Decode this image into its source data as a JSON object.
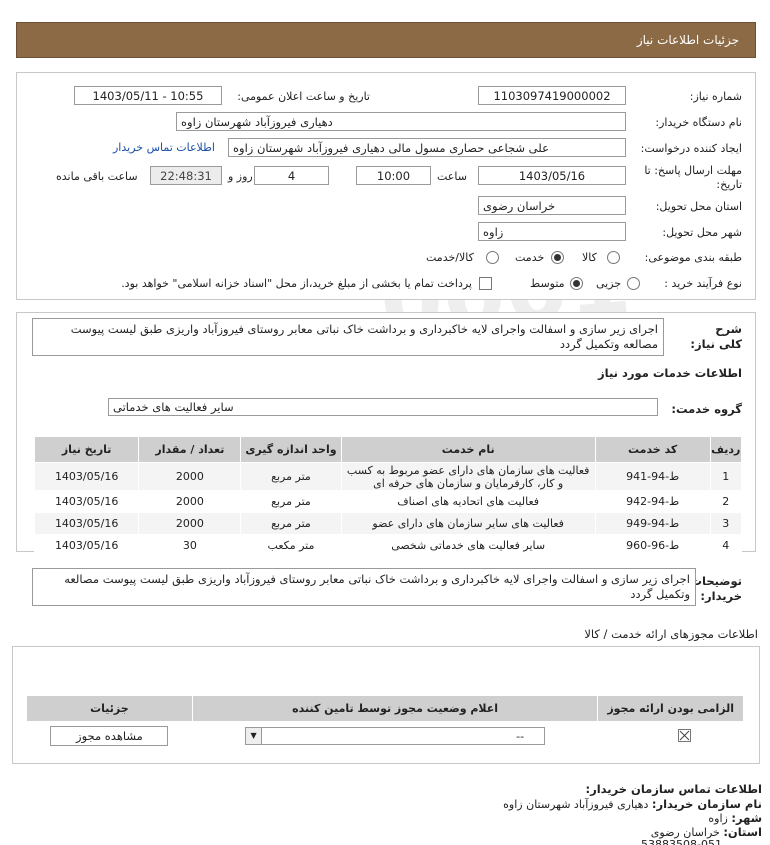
{
  "header": {
    "title": "جزئیات اطلاعات نیاز"
  },
  "form": {
    "need_number_label": "شماره نیاز:",
    "need_number": "1103097419000002",
    "announce_label": "تاریخ و ساعت اعلان عمومی:",
    "announce_value": "1403/05/11 - 10:55",
    "buyer_org_label": "نام دستگاه خریدار:",
    "buyer_org": "دهیاری فیروزآباد شهرستان زاوه",
    "requester_label": "ایجاد کننده درخواست:",
    "requester": "علی شجاعی حصاری مسول مالی دهیاری فیروزآباد شهرستان زاوه",
    "buyer_contact_link": "اطلاعات تماس خریدار",
    "deadline_label": "مهلت ارسال پاسخ: تا تاریخ:",
    "deadline_date": "1403/05/16",
    "time_label": "ساعت",
    "deadline_time": "10:00",
    "days_value": "4",
    "days_label": "روز و",
    "remaining_time": "22:48:31",
    "remaining_label": "ساعت باقی مانده",
    "province_label": "استان محل تحویل:",
    "province": "خراسان رضوی",
    "city_label": "شهر محل تحویل:",
    "city": "زاوه",
    "category_label": "طبقه بندی موضوعی:",
    "category_options": [
      "کالا",
      "خدمت",
      "کالا/خدمت"
    ],
    "category_selected": "خدمت",
    "purchase_type_label": "نوع فرآیند خرید :",
    "purchase_options": [
      "جزیی",
      "متوسط"
    ],
    "purchase_selected": "متوسط",
    "payment_text": "پرداخت تمام یا بخشی از مبلغ خرید،از محل \"اسناد خزانه اسلامی\" خواهد بود."
  },
  "summary": {
    "label": "شرح کلی نیاز:",
    "text": "اجرای زیر سازی و اسفالت واجرای لایه خاکبرداری و برداشت خاک نباتی معابر روستای فیروزآباد واریزی طبق لیست پیوست مصالعه وتکمیل گردد"
  },
  "services": {
    "section_title": "اطلاعات خدمات مورد نیاز",
    "group_label": "گروه خدمت:",
    "group_value": "سایر فعالیت های خدماتی",
    "columns": [
      "ردیف",
      "کد خدمت",
      "نام خدمت",
      "واحد اندازه گیری",
      "تعداد / مقدار",
      "تاریخ نیاز"
    ],
    "rows": [
      {
        "idx": "1",
        "code": "ط-94-941",
        "name": "فعالیت های سازمان های دارای عضو مربوط به کسب و کار، کارفرمایان و سازمان های حرفه ای",
        "unit": "متر مربع",
        "qty": "2000",
        "date": "1403/05/16"
      },
      {
        "idx": "2",
        "code": "ط-94-942",
        "name": "فعالیت های اتحادیه های اصناف",
        "unit": "متر مربع",
        "qty": "2000",
        "date": "1403/05/16"
      },
      {
        "idx": "3",
        "code": "ط-94-949",
        "name": "فعالیت های سایر سازمان های دارای عضو",
        "unit": "متر مربع",
        "qty": "2000",
        "date": "1403/05/16"
      },
      {
        "idx": "4",
        "code": "ط-96-960",
        "name": "سایر فعالیت های خدماتی شخصی",
        "unit": "متر مکعب",
        "qty": "30",
        "date": "1403/05/16"
      }
    ]
  },
  "buyer_notes": {
    "label": "توضیحات خریدار:",
    "text": "اجرای زیر سازی و اسفالت واجرای لایه خاکبرداری و برداشت خاک نباتی معابر روستای فیروزآباد واریزی طبق لیست پیوست مصالعه وتکمیل گردد"
  },
  "permits": {
    "section_title": "اطلاعات مجوزهای ارائه خدمت / کالا",
    "columns": [
      "الزامی بودن ارائه مجوز",
      "اعلام وضعیت مجوز توسط تامین کننده",
      "جزئیات"
    ],
    "select_value": "--",
    "view_button": "مشاهده مجوز"
  },
  "contact": {
    "title": "اطلاعات تماس سازمان خریدار:",
    "org_label": "نام سازمان خریدار:",
    "org_value": "دهیاری فیروزآباد شهرستان زاوه",
    "city_label": "شهر:",
    "city_value": "زاوه",
    "province_label": "استان:",
    "province_value": "خراسان رضوی",
    "phone": "53883508-051"
  },
  "colors": {
    "title_bar": "#8b6a45",
    "table_header": "#cfcfcf",
    "link": "#1a4fa8"
  }
}
